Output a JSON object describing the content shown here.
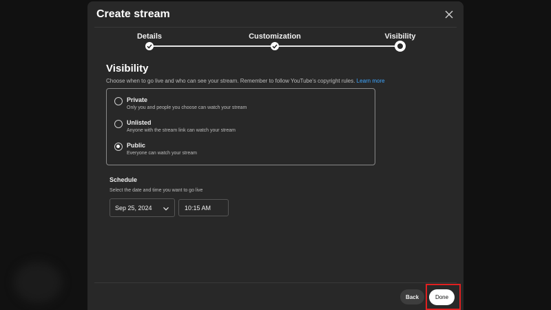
{
  "dialog": {
    "title": "Create stream"
  },
  "stepper": {
    "steps": [
      {
        "label": "Details",
        "state": "done"
      },
      {
        "label": "Customization",
        "state": "done"
      },
      {
        "label": "Visibility",
        "state": "current"
      }
    ]
  },
  "visibility": {
    "title": "Visibility",
    "description": "Choose when to go live and who can see your stream. Remember to follow YouTube's copyright rules.",
    "learn_more": "Learn more",
    "options": [
      {
        "label": "Private",
        "sub": "Only you and people you choose can watch your stream",
        "checked": false
      },
      {
        "label": "Unlisted",
        "sub": "Anyone with the stream link can watch your stream",
        "checked": false
      },
      {
        "label": "Public",
        "sub": "Everyone can watch your stream",
        "checked": true
      }
    ]
  },
  "schedule": {
    "title": "Schedule",
    "description": "Select the date and time you want to go live",
    "date": "Sep 25, 2024",
    "time": "10:15 AM"
  },
  "footer": {
    "back_label": "Back",
    "done_label": "Done"
  },
  "colors": {
    "dialog_bg": "#282828",
    "link": "#3ea6ff",
    "highlight": "#e02020"
  }
}
